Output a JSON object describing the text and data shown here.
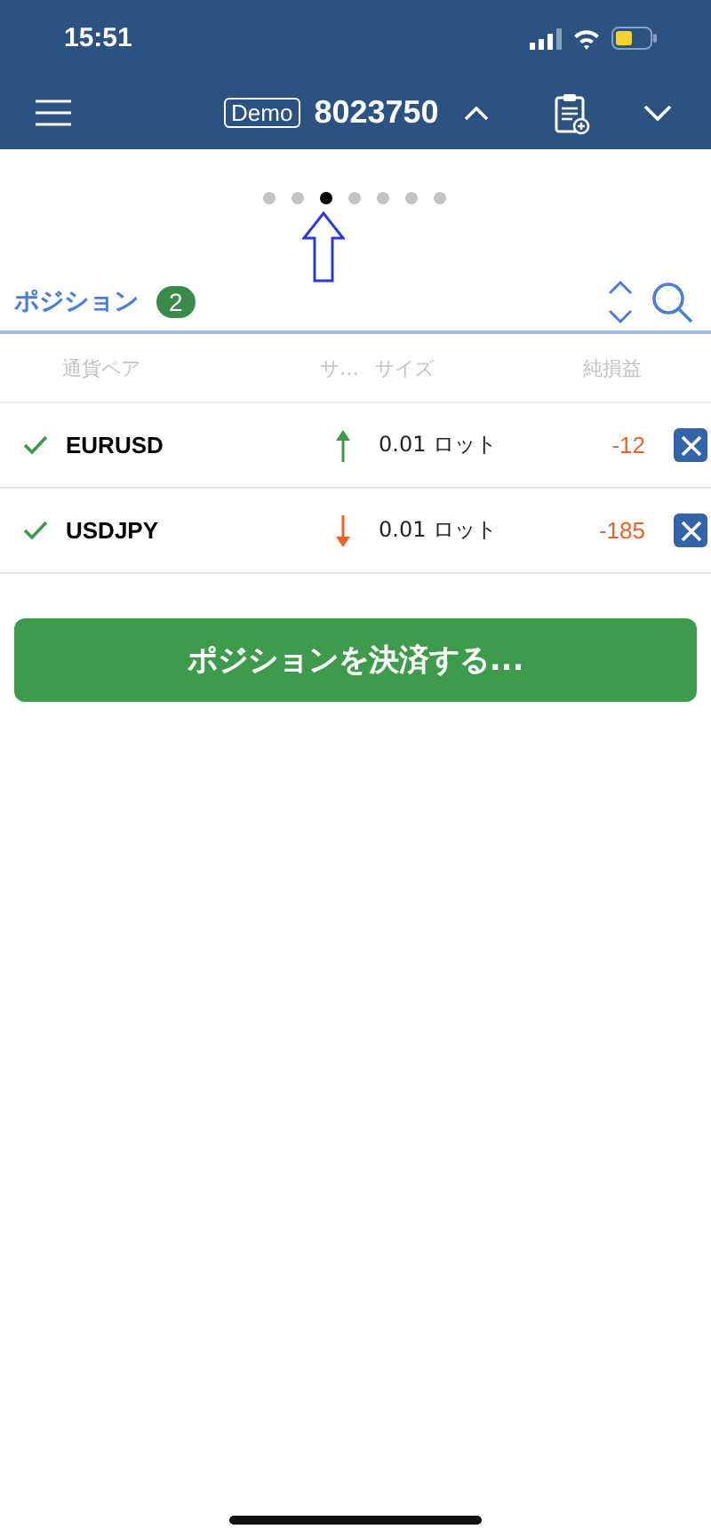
{
  "status_bar": {
    "time": "15:51"
  },
  "header": {
    "badge": "Demo",
    "account": "8023750"
  },
  "pager": {
    "dots": [
      {
        "selected": false
      },
      {
        "selected": false
      },
      {
        "selected": true
      },
      {
        "selected": false
      },
      {
        "selected": false
      },
      {
        "selected": false
      },
      {
        "selected": false
      }
    ]
  },
  "positions": {
    "title": "ポジション",
    "count": "2"
  },
  "table": {
    "columns": [
      "通貨ペア",
      "サ…",
      "サイズ",
      "純損益"
    ],
    "rows": [
      {
        "checked": true,
        "symbol": "EURUSD",
        "kind": "buy",
        "size": "0.01 ロット",
        "pnl": "-12"
      },
      {
        "checked": true,
        "symbol": "USDJPY",
        "kind": "sell",
        "size": "0.01 ロット",
        "pnl": "-185"
      }
    ]
  },
  "close_button": "ポジションを決済する..."
}
